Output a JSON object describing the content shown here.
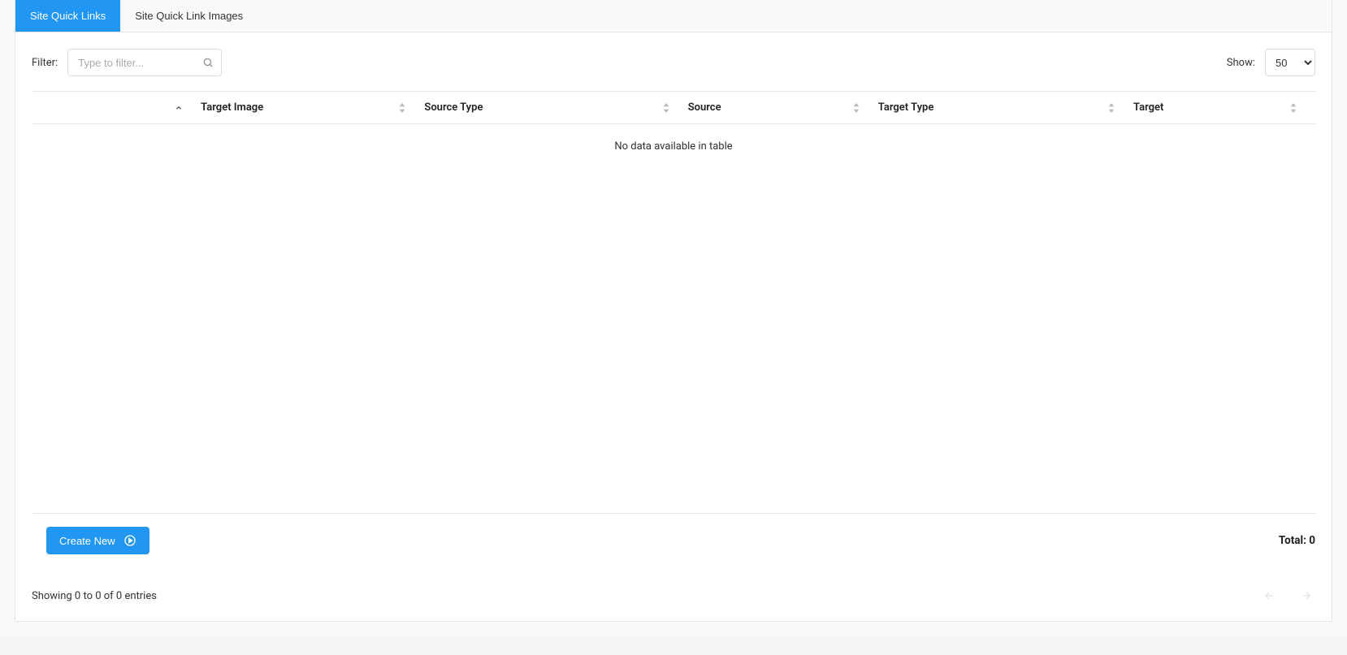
{
  "tabs": [
    {
      "label": "Site Quick Links",
      "active": true
    },
    {
      "label": "Site Quick Link Images",
      "active": false
    }
  ],
  "filter": {
    "label": "Filter:",
    "placeholder": "Type to filter...",
    "value": ""
  },
  "show": {
    "label": "Show:",
    "selected": "50"
  },
  "columns": [
    {
      "label": "Target Image",
      "sort": "asc"
    },
    {
      "label": "Source Type",
      "sort": "both"
    },
    {
      "label": "Source",
      "sort": "both"
    },
    {
      "label": "Target Type",
      "sort": "both"
    },
    {
      "label": "Target",
      "sort": "both"
    }
  ],
  "empty_message": "No data available in table",
  "create_button": "Create New",
  "total": {
    "label": "Total:",
    "value": "0"
  },
  "showing_text": "Showing 0 to 0 of 0 entries"
}
